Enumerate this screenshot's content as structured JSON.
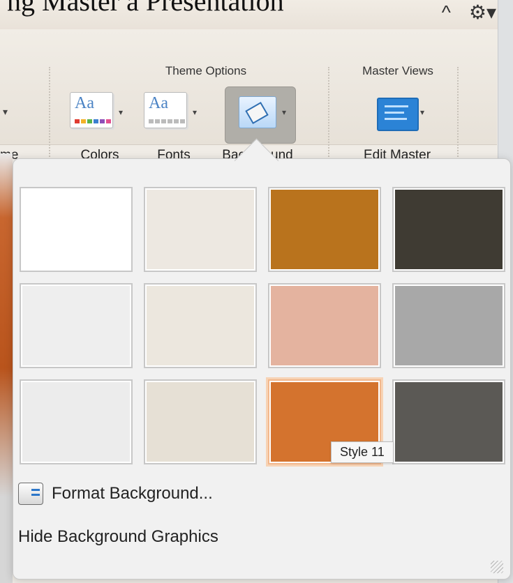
{
  "window": {
    "top_text": "ng Master a Presentation",
    "controls": [
      "^",
      "⚙▾"
    ]
  },
  "ribbon": {
    "partial_left_label": "me",
    "groups": {
      "theme_options": "Theme Options",
      "master_views": "Master Views"
    },
    "tools": {
      "colors": "Colors",
      "fonts": "Fonts",
      "background": "Background",
      "edit_master": "Edit Master"
    },
    "icon_text": {
      "aa": "Aa"
    }
  },
  "background_styles": {
    "tooltip": "Style 11",
    "selected_index": 10,
    "styles": [
      {
        "color": "#ffffff"
      },
      {
        "color": "#ede8e1"
      },
      {
        "color": "#b9731d"
      },
      {
        "color": "#3f3b33"
      },
      {
        "color": "#eeeeee"
      },
      {
        "color": "#ece7de"
      },
      {
        "color": "#e4b39f"
      },
      {
        "color": "#a8a8a8"
      },
      {
        "color": "#ececec"
      },
      {
        "color": "#e6e0d5"
      },
      {
        "color": "#d4732e"
      },
      {
        "color": "#5b5955"
      }
    ]
  },
  "menu": {
    "format_background": "Format Background...",
    "hide_background_graphics": "Hide Background Graphics"
  }
}
